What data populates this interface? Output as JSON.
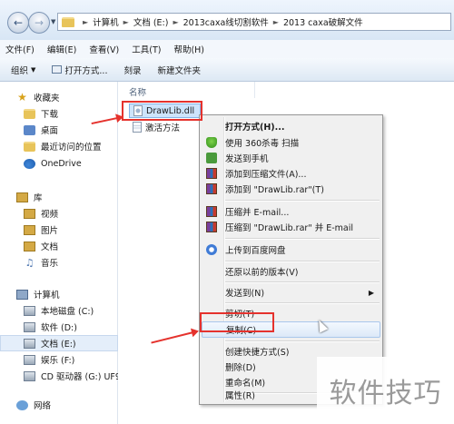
{
  "address_bar": {
    "breadcrumbs": [
      "计算机",
      "文档 (E:)",
      "2013caxa线切割软件",
      "2013 caxa破解文件"
    ]
  },
  "menu": {
    "items": [
      "文件(F)",
      "编辑(E)",
      "查看(V)",
      "工具(T)",
      "帮助(H)"
    ]
  },
  "toolbar": {
    "organize": "组织",
    "open_with": "打开方式...",
    "burn": "刻录",
    "new_folder": "新建文件夹"
  },
  "sidebar": {
    "favorites": "收藏夹",
    "fav_items": [
      "下载",
      "桌面",
      "最近访问的位置"
    ],
    "onedrive": "OneDrive",
    "libraries": "库",
    "lib_items": [
      "视频",
      "图片",
      "文档",
      "音乐"
    ],
    "computer": "计算机",
    "drives": [
      "本地磁盘 (C:)",
      "软件 (D:)",
      "文档 (E:)",
      "娱乐 (F:)",
      "CD 驱动器 (G:) UF9"
    ],
    "network": "网络"
  },
  "content": {
    "column_name": "名称",
    "files": [
      "DrawLib.dll",
      "激活方法"
    ]
  },
  "context_menu": {
    "open_with": "打开方式(H)...",
    "scan_360": "使用 360杀毒 扫描",
    "send_phone": "发送到手机",
    "add_archive": "添加到压缩文件(A)...",
    "add_rar": "添加到 \"DrawLib.rar\"(T)",
    "zip_email": "压缩并 E-mail...",
    "zip_rar_email": "压缩到 \"DrawLib.rar\" 并 E-mail",
    "upload_baidu": "上传到百度网盘",
    "restore_versions": "还原以前的版本(V)",
    "send_to": "发送到(N)",
    "cut": "剪切(T)",
    "copy": "复制(C)",
    "create_shortcut": "创建快捷方式(S)",
    "delete": "删除(D)",
    "rename": "重命名(M)",
    "properties": "属性(R)"
  },
  "watermark": "软件技巧",
  "colors": {
    "annotation": "#e5322d",
    "selection": "#cde4fb",
    "folder": "#e8c45a"
  }
}
